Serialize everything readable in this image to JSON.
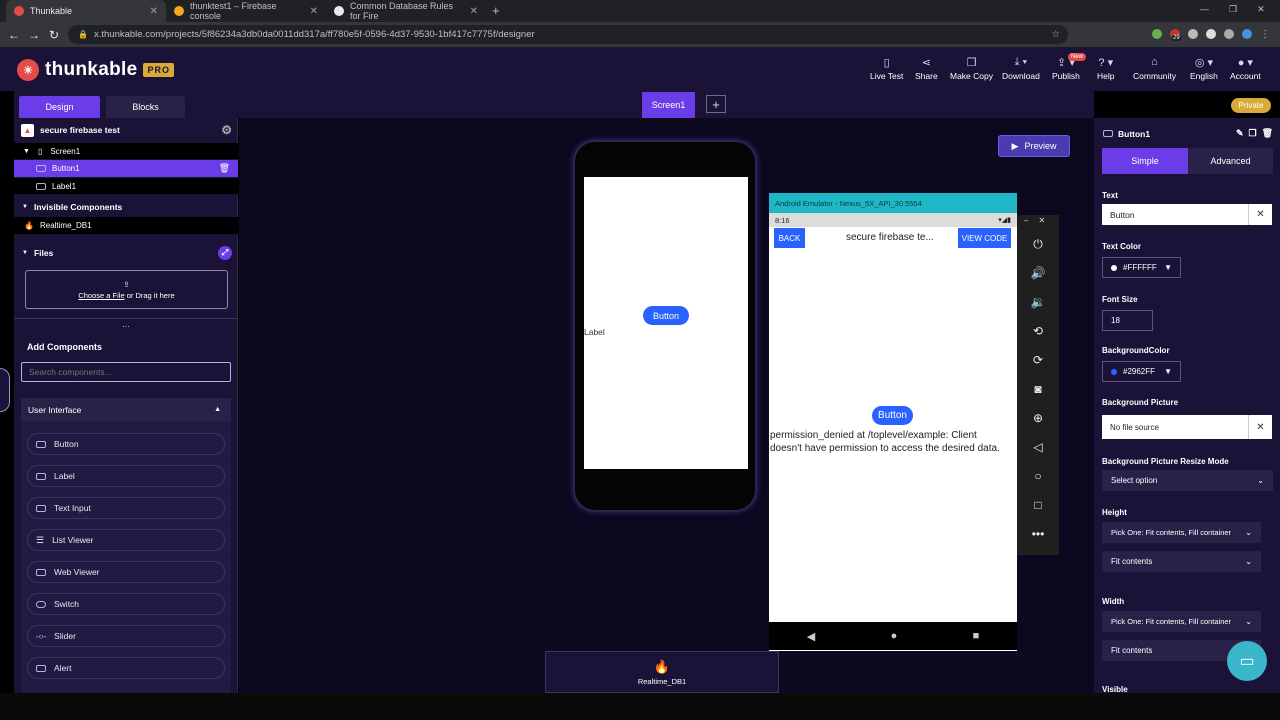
{
  "browser": {
    "tabs": [
      {
        "title": "Thunkable",
        "favicon_color": "#e54b4b"
      },
      {
        "title": "thunktest1 – Firebase console",
        "favicon_color": "#f5a623"
      },
      {
        "title": "Common Database Rules for Fire",
        "favicon_color": "#e8eaed"
      }
    ],
    "url": "x.thunkable.com/projects/5f86234a3db0da0011dd317a/ff780e5f-0596-4d37-9530-1bf417c7775f/designer",
    "badge_count": "29"
  },
  "header": {
    "brand": "thunkable",
    "pro_badge": "PRO",
    "actions": [
      "Live Test",
      "Share",
      "Make Copy",
      "Download",
      "Publish",
      "Help",
      "Community",
      "English",
      "Account"
    ],
    "new_badge": "New"
  },
  "modes": {
    "design": "Design",
    "blocks": "Blocks"
  },
  "screen_tab": "Screen1",
  "private_badge": "Private",
  "tree": {
    "project": "secure firebase test",
    "screen": "Screen1",
    "items": [
      "Button1",
      "Label1"
    ],
    "invisible_header": "Invisible Components",
    "invisible_items": [
      "Realtime_DB1"
    ],
    "files_header": "Files",
    "upload_link": "Choose a File",
    "upload_rest": " or Drag it here",
    "more": "..."
  },
  "add_components": {
    "title": "Add Components",
    "search_placeholder": "Search components...",
    "category": "User Interface",
    "items": [
      "Button",
      "Label",
      "Text Input",
      "List Viewer",
      "Web Viewer",
      "Switch",
      "Slider",
      "Alert"
    ]
  },
  "canvas": {
    "button_label": "Button",
    "label_text": "Label",
    "preview": "Preview",
    "tray_item": "Realtime_DB1"
  },
  "emulator": {
    "title": "Android Emulator - Nexus_5X_API_30:5554",
    "time": "8:16",
    "back": "BACK",
    "app_title": "secure firebase te...",
    "view_code": "VIEW CODE",
    "button_label": "Button",
    "error_text": "permission_denied at /toplevel/example: Client doesn't have permission to access the desired data."
  },
  "properties": {
    "component": "Button1",
    "tabs": {
      "simple": "Simple",
      "advanced": "Advanced"
    },
    "text_label": "Text",
    "text_value": "Button",
    "text_color_label": "Text Color",
    "text_color_value": "#FFFFFF",
    "font_size_label": "Font Size",
    "font_size_value": "18",
    "bg_color_label": "BackgroundColor",
    "bg_color_value": "#2962FF",
    "bg_picture_label": "Background Picture",
    "bg_picture_value": "No file source",
    "resize_label": "Background Picture Resize Mode",
    "resize_value": "Select option",
    "height_label": "Height",
    "height_pick": "Pick One: Fit contents, Fill container",
    "height_value": "Fit contents",
    "width_label": "Width",
    "width_pick": "Pick One: Fit contents, Fill container",
    "width_value": "Fit contents",
    "visible_label": "Visible"
  },
  "colors": {
    "accent": "#6a3de8",
    "button_blue": "#2962ff",
    "panel": "#1b1238"
  }
}
